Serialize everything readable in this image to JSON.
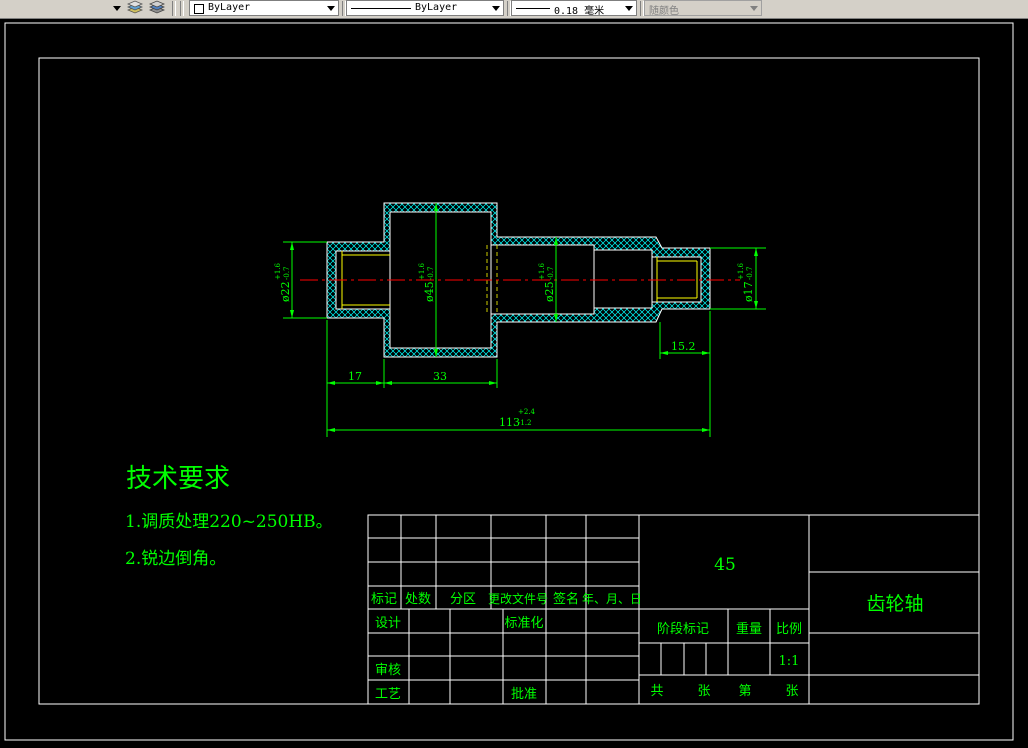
{
  "toolbar": {
    "layer_dropdown_value": "ByLayer",
    "linetype_dropdown_value": "ByLayer",
    "lineweight_dropdown_value": "0.18 毫米",
    "plotstyle_dropdown_value": "随颜色",
    "icons": [
      "dropdown-arrow-icon",
      "layer-stack-icon",
      "layer-stack-2-icon"
    ]
  },
  "drawing": {
    "colors": {
      "border": "#ffffff",
      "part_outline": "#ffffff",
      "hatch": "#00ffff",
      "dimension": "#00ff00",
      "text": "#00ff00",
      "centerline": "#ff0000",
      "thread": "#ffff00"
    },
    "dimensions": {
      "dia_left": "ø22",
      "dia_left_tol_upper": "+1.6",
      "dia_left_tol_lower": "-0.7",
      "dia_big": "ø45",
      "dia_big_tol_upper": "+1.6",
      "dia_big_tol_lower": "-0.7",
      "dia_mid": "ø25",
      "dia_mid_tol_upper": "+1.6",
      "dia_mid_tol_lower": "-0.7",
      "dia_right": "ø17",
      "dia_right_tol_upper": "+1.6",
      "dia_right_tol_lower": "-0.7",
      "len_17": "17",
      "len_33": "33",
      "len_15_2": "15.2",
      "total_len": "113",
      "total_len_tol_upper": "+2.4",
      "total_len_tol_lower": "-1.2"
    },
    "tech_requirements": {
      "title": "技术要求",
      "item1": "1.调质处理220~250HB。",
      "item2": "2.锐边倒角。"
    },
    "title_block": {
      "material": "45",
      "part_name": "齿轮轴",
      "hdr_mark": "标记",
      "hdr_count": "处数",
      "hdr_zone": "分区",
      "hdr_doc": "更改文件号",
      "hdr_sign": "签名",
      "hdr_date": "年、月、日",
      "design": "设计",
      "standardize": "标准化",
      "review": "审核",
      "process": "工艺",
      "approve": "批准",
      "stage_mark": "阶段标记",
      "weight": "重量",
      "scale_label": "比例",
      "scale_value": "1:1",
      "total_label": "共",
      "sheets_label": "张",
      "page_label": "第",
      "page_sheets_label": "张"
    }
  }
}
